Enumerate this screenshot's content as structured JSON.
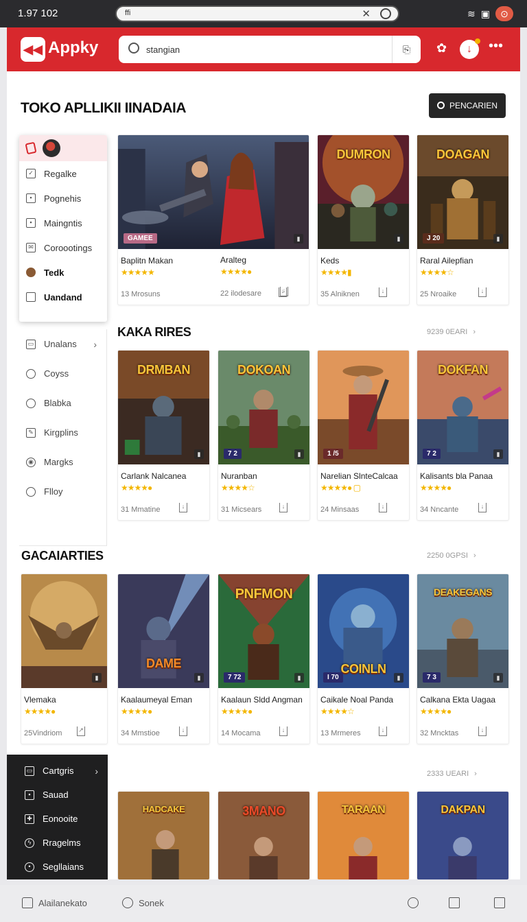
{
  "status": {
    "time": "1.97 102",
    "url": "ffi"
  },
  "app": {
    "brand": "Appky",
    "search_value": "stangian",
    "page_title": "TOKO APLLIKII IINADAIA",
    "search_button": "PENCARIEN"
  },
  "sidebar": {
    "popup_items": [
      {
        "label": "Regalke",
        "icon": "checkbox-icon"
      },
      {
        "label": "Pognehis",
        "icon": "grid-icon"
      },
      {
        "label": "Maingntis",
        "icon": "page-icon"
      },
      {
        "label": "Coroootings",
        "icon": "mail-icon"
      },
      {
        "label": "Tedk",
        "icon": "cookie-icon"
      },
      {
        "label": "Uandand",
        "icon": "tag-icon"
      }
    ],
    "list_items": [
      {
        "label": "Unalans",
        "icon": "wallet-icon",
        "chevron": "›"
      },
      {
        "label": "Coyss",
        "icon": "chat-icon"
      },
      {
        "label": "Blabka",
        "icon": "share-icon"
      },
      {
        "label": "Kirgplins",
        "icon": "pen-icon"
      },
      {
        "label": "Margks",
        "icon": "camera-icon"
      },
      {
        "label": "Flloy",
        "icon": "clock-icon"
      }
    ],
    "dark_items": [
      {
        "label": "Cartgris",
        "icon": "card-icon",
        "chevron": "›"
      },
      {
        "label": "Sauad",
        "icon": "save-icon"
      },
      {
        "label": "Eonooite",
        "icon": "gift-icon"
      },
      {
        "label": "Rragelms",
        "icon": "bolt-icon"
      },
      {
        "label": "Segllaians",
        "icon": "target-icon"
      }
    ]
  },
  "sections": [
    {
      "title": "",
      "count": "",
      "cards": [
        {
          "name": "Baplitn Makan",
          "meta": "13 Mrosuns",
          "stars": "★★★★★",
          "badge": "GAMEE",
          "art_title": ""
        },
        {
          "name": "Aralteg",
          "meta": "22 ilodesare",
          "stars": "★★★★●",
          "badge": "",
          "art_title": ""
        },
        {
          "name": "Keds",
          "meta": "35 Alniknen",
          "stars": "★★★★▮",
          "badge": "",
          "art_title": "DUMRON"
        },
        {
          "name": "Raral Ailepfian",
          "meta": "25 Nroaike",
          "stars": "★★★★☆",
          "badge": "J 20",
          "art_title": "DOAGAN"
        }
      ]
    },
    {
      "title": "KAKA RIRES",
      "count": "9239 0EARI",
      "cards": [
        {
          "name": "Carlank Nalcanea",
          "meta": "31 Mmatine",
          "stars": "★★★★●",
          "badge": "",
          "art_title": "DRMBAN"
        },
        {
          "name": "Nuranban",
          "meta": "31 Micsears",
          "stars": "★★★★☆",
          "badge": "7 2",
          "art_title": "DOKOAN"
        },
        {
          "name": "Narelian SlnteCalcaa",
          "meta": "24 Minsaas",
          "stars": "★★★★● ▢",
          "badge": "1 /5",
          "art_title": ""
        },
        {
          "name": "Kalisants bla Panaa",
          "meta": "34 Nncante",
          "stars": "★★★★●",
          "badge": "7 2",
          "art_title": "DOKFAN"
        }
      ]
    },
    {
      "title": "GACAIARTIES",
      "count": "2250 0GPSI",
      "cards": [
        {
          "name": "Vlemaka",
          "meta": "25Vindriom",
          "stars": "★★★★●",
          "badge": "",
          "art_title": ""
        },
        {
          "name": "Kaalaumeyal Eman",
          "meta": "34 Mmstioe",
          "stars": "★★★★●",
          "badge": "",
          "art_title": "DAME"
        },
        {
          "name": "Kaalaun Sldd Angman",
          "meta": "14 Mocama",
          "stars": "★★★★●",
          "badge": "7 72",
          "art_title": "PNFMON"
        },
        {
          "name": "Caikale Noal Panda",
          "meta": "13 Mrmeres",
          "stars": "★★★★☆",
          "badge": "I 70",
          "art_title": "COINLN"
        },
        {
          "name": "Calkana Ekta Uagaa",
          "meta": "32 Mncktas",
          "stars": "★★★★●",
          "badge": "7 3",
          "art_title": "DEAKEGANS"
        }
      ]
    },
    {
      "title": "",
      "count": "2333 UEARI",
      "cards": [
        {
          "art_title": "HADCAKE"
        },
        {
          "art_title": "3MANO"
        },
        {
          "art_title": "TARAAN"
        },
        {
          "art_title": "DAKPAN"
        }
      ]
    }
  ],
  "bottombar": {
    "left": "Alailanekato",
    "middle": "Sonek"
  },
  "colors": {
    "brand_red": "#d8282d",
    "star": "#f3b600",
    "dark_sidebar": "#1f1f20"
  }
}
